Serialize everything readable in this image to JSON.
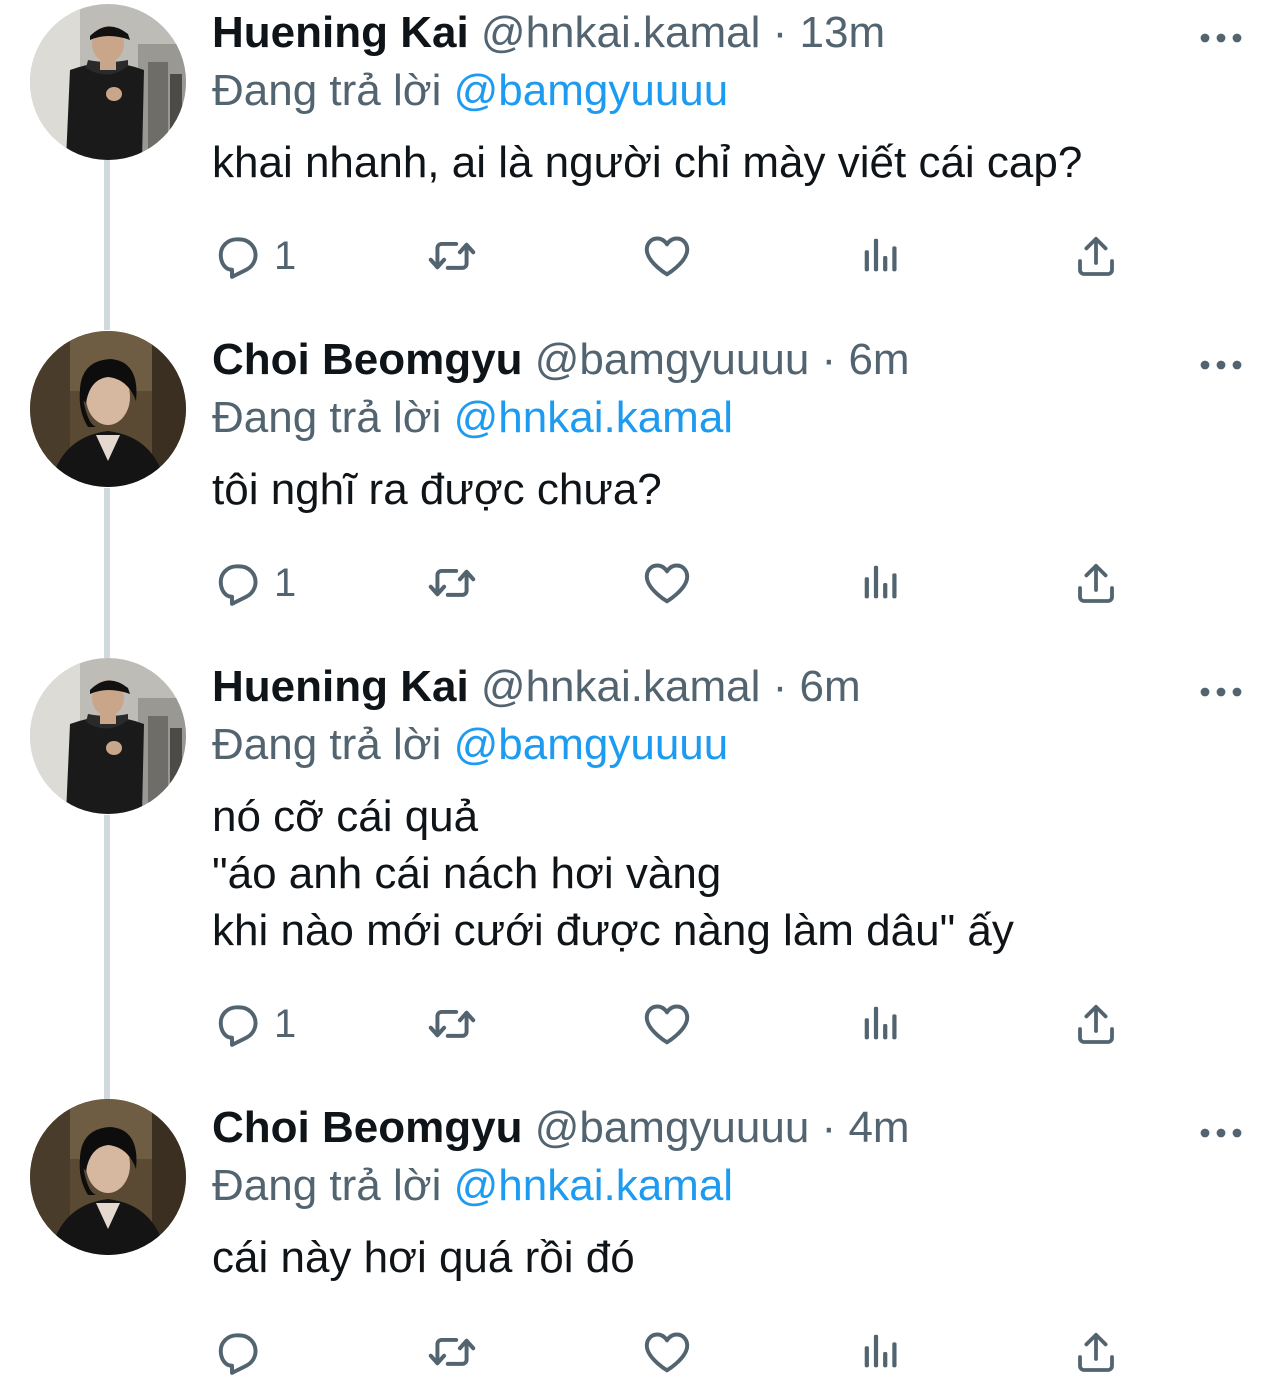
{
  "tweets": [
    {
      "display_name": "Huening Kai",
      "handle": "@hnkai.kamal",
      "separator": "·",
      "time": "13m",
      "reply_prefix": "Đang trả lời",
      "reply_to": "@bamgyuuuu",
      "text": "khai nhanh, ai là người chỉ mày viết cái cap?",
      "reply_count": "1",
      "avatar_icon": "profile-photo-black-shirt-cap",
      "more_icon": "more-dots-icon"
    },
    {
      "display_name": "Choi Beomgyu",
      "handle": "@bamgyuuuu",
      "separator": "·",
      "time": "6m",
      "reply_prefix": "Đang trả lời",
      "reply_to": "@hnkai.kamal",
      "text": "tôi nghĩ ra được chưa?",
      "reply_count": "1",
      "avatar_icon": "profile-photo-dark-hair-jacket",
      "more_icon": "more-dots-icon"
    },
    {
      "display_name": "Huening Kai",
      "handle": "@hnkai.kamal",
      "separator": "·",
      "time": "6m",
      "reply_prefix": "Đang trả lời",
      "reply_to": "@bamgyuuuu",
      "text": "nó cỡ cái quả\n\"áo anh cái nách hơi vàng\nkhi nào mới cưới được nàng làm dâu\" ấy",
      "reply_count": "1",
      "avatar_icon": "profile-photo-black-shirt-cap",
      "more_icon": "more-dots-icon"
    },
    {
      "display_name": "Choi Beomgyu",
      "handle": "@bamgyuuuu",
      "separator": "·",
      "time": "4m",
      "reply_prefix": "Đang trả lời",
      "reply_to": "@hnkai.kamal",
      "text": "cái này hơi quá rồi đó",
      "reply_count": "",
      "avatar_icon": "profile-photo-dark-hair-jacket",
      "more_icon": "more-dots-icon"
    }
  ],
  "action_icons": [
    "reply-icon",
    "retweet-icon",
    "like-icon",
    "analytics-icon",
    "share-icon"
  ],
  "colors": {
    "text_primary": "#0f1419",
    "text_secondary": "#536471",
    "link": "#1d9bf0",
    "thread_line": "#cfd9de",
    "background": "#ffffff"
  }
}
